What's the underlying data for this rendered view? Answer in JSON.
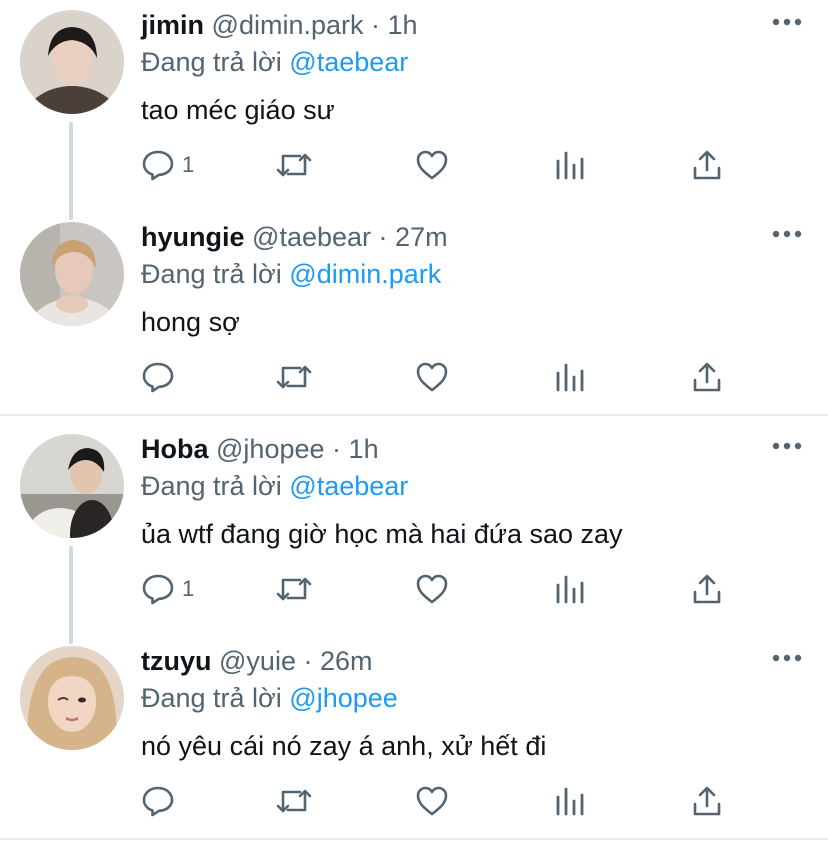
{
  "replying_prefix": "Đang trả lời",
  "separator": "·",
  "tweets": [
    {
      "name": "jimin",
      "handle": "@dimin.park",
      "time": "1h",
      "reply_to": "@taebear",
      "text": "tao méc giáo sư",
      "reply_count": "1",
      "has_thread_line": true
    },
    {
      "name": "hyungie",
      "handle": "@taebear",
      "time": "27m",
      "reply_to": "@dimin.park",
      "text": "hong sợ",
      "reply_count": "",
      "has_thread_line": false
    },
    {
      "name": "Hoba",
      "handle": "@jhopee",
      "time": "1h",
      "reply_to": "@taebear",
      "text": "ủa wtf đang giờ học mà hai đứa sao zay",
      "reply_count": "1",
      "has_thread_line": true
    },
    {
      "name": "tzuyu",
      "handle": "@yuie",
      "time": "26m",
      "reply_to": "@jhopee",
      "text": "nó yêu cái nó zay á anh, xử hết đi",
      "reply_count": "",
      "has_thread_line": false
    }
  ],
  "colors": {
    "accent": "#1d9bf0",
    "secondary_text": "#536471",
    "primary_text": "#0f1419",
    "divider": "#e7ebee",
    "thread_line": "#cfd9de"
  },
  "icons": [
    "reply-icon",
    "retweet-icon",
    "like-icon",
    "analytics-icon",
    "share-icon",
    "more-icon"
  ]
}
